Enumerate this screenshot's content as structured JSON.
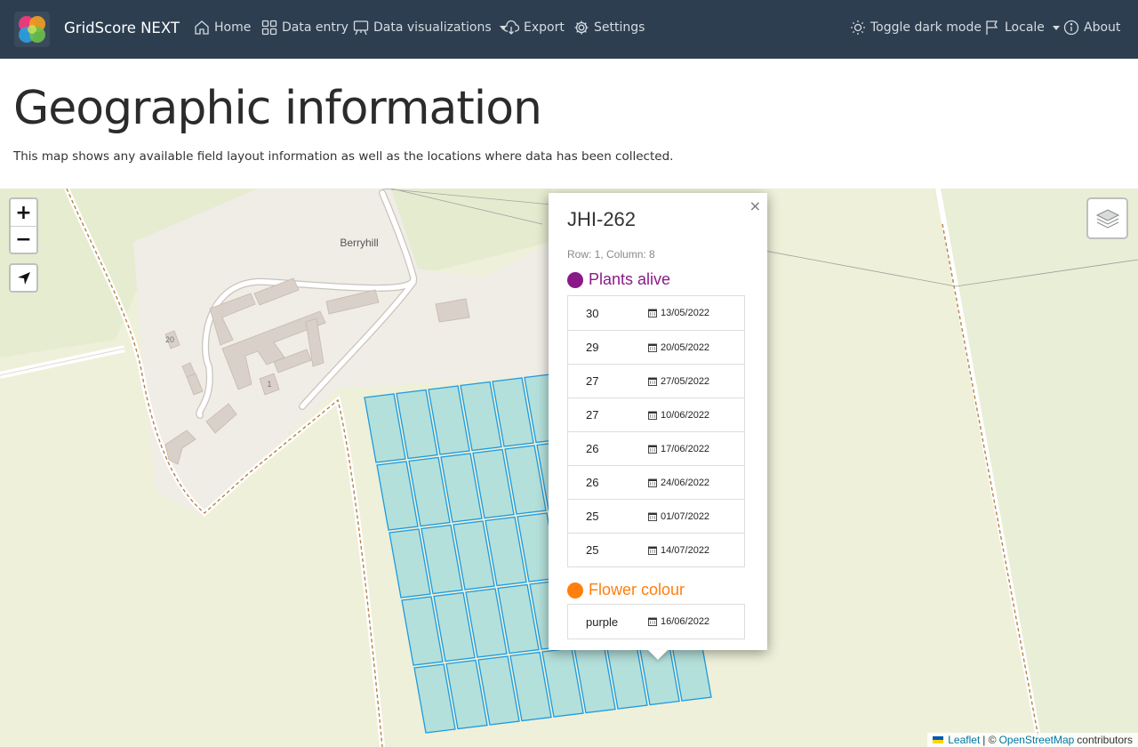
{
  "nav": {
    "brand": "GridScore NEXT",
    "home": "Home",
    "data_entry": "Data entry",
    "data_vis": "Data visualizations",
    "export": "Export",
    "settings": "Settings",
    "dark_mode": "Toggle dark mode",
    "locale": "Locale",
    "about": "About"
  },
  "page": {
    "title": "Geographic information",
    "description": "This map shows any available field layout information as well as the locations where data has been collected."
  },
  "map": {
    "place_label": "Berryhill",
    "building_label_20": "20",
    "building_label_1": "1",
    "zoom_in": "+",
    "zoom_out": "−",
    "attribution": {
      "leaflet": "Leaflet",
      "separator": "| ©",
      "osm": "OpenStreetMap",
      "contributors": "contributors"
    }
  },
  "popup": {
    "close": "×",
    "title": "JHI-262",
    "subtitle": "Row: 1, Column: 8",
    "traits": [
      {
        "name": "Plants alive",
        "color": "#8b1a89",
        "rows": [
          {
            "value": "30",
            "date": "13/05/2022"
          },
          {
            "value": "29",
            "date": "20/05/2022"
          },
          {
            "value": "27",
            "date": "27/05/2022"
          },
          {
            "value": "27",
            "date": "10/06/2022"
          },
          {
            "value": "26",
            "date": "17/06/2022"
          },
          {
            "value": "26",
            "date": "24/06/2022"
          },
          {
            "value": "25",
            "date": "01/07/2022"
          },
          {
            "value": "25",
            "date": "14/07/2022"
          }
        ]
      },
      {
        "name": "Flower colour",
        "color": "#ff7f0e",
        "rows": [
          {
            "value": "purple",
            "date": "16/06/2022"
          }
        ]
      }
    ]
  },
  "colors": {
    "navbar": "#2d3e50",
    "map_background": "#eef0d9",
    "plot_fill": "#b4e0db",
    "plot_stroke": "#1e9be0"
  }
}
